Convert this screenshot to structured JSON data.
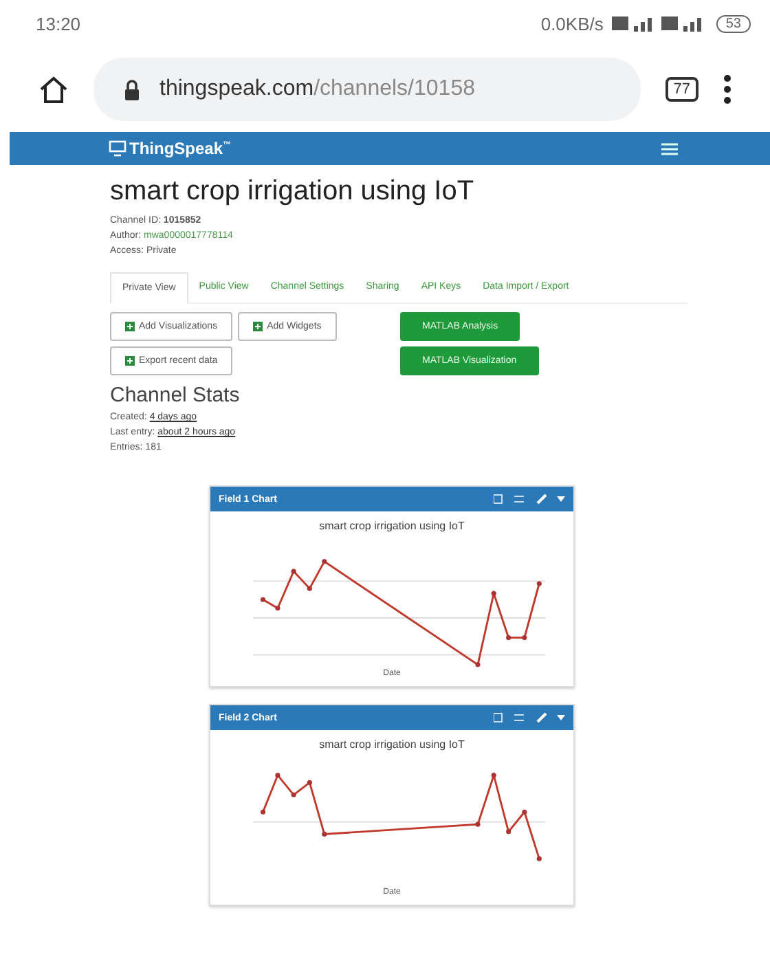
{
  "status_bar": {
    "time": "13:20",
    "speed": "0.0KB/s",
    "battery": "53"
  },
  "browser": {
    "url_host": "thingspeak.com",
    "url_path": "/channels/10158",
    "tab_count": "77"
  },
  "nav": {
    "brand": "ThingSpeak",
    "trademark": "™"
  },
  "channel": {
    "title": "smart crop irrigation using IoT",
    "id_label": "Channel ID:",
    "id": "1015852",
    "author_label": "Author:",
    "author": "mwa0000017778114",
    "access": "Access: Private"
  },
  "tabs": [
    {
      "label": "Private View",
      "selected": true
    },
    {
      "label": "Public View",
      "selected": false
    },
    {
      "label": "Channel Settings",
      "selected": false
    },
    {
      "label": "Sharing",
      "selected": false
    },
    {
      "label": "API Keys",
      "selected": false
    },
    {
      "label": "Data Import / Export",
      "selected": false
    }
  ],
  "actions": [
    {
      "label": "Add Visualizations",
      "kind": "outline"
    },
    {
      "label": "Add Widgets",
      "kind": "outline"
    },
    {
      "label": "Export recent data",
      "kind": "outline"
    }
  ],
  "matlab": [
    {
      "label": "MATLAB Analysis"
    },
    {
      "label": "MATLAB Visualization"
    }
  ],
  "stats": {
    "heading": "Channel Stats",
    "created_label": "Created:",
    "created": "4 days ago",
    "last_label": "Last entry:",
    "last": "about 2 hours ago",
    "entries": "Entries: 181"
  },
  "charts": [
    {
      "header": "Field 1 Chart",
      "title": "smart crop irrigation using IoT",
      "xlabel": "Date"
    },
    {
      "header": "Field 2 Chart",
      "title": "smart crop irrigation using IoT",
      "xlabel": "Date"
    }
  ]
}
